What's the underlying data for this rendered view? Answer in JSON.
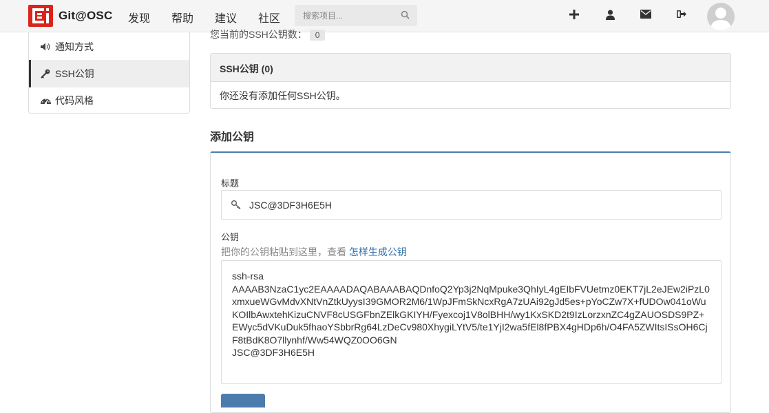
{
  "brand": {
    "name": "Git@OSC",
    "color": "#d9251c"
  },
  "nav": {
    "links": [
      "发现",
      "帮助",
      "建议",
      "社区"
    ],
    "search_placeholder": "搜索项目...",
    "icons": [
      "plus-icon",
      "user-icon",
      "envelope-icon",
      "sign-out-icon"
    ]
  },
  "sidebar": {
    "items": [
      {
        "label": "通知方式",
        "icon": "volume-icon",
        "active": false
      },
      {
        "label": "SSH公钥",
        "icon": "key-icon",
        "active": true
      },
      {
        "label": "代码风格",
        "icon": "dashboard-icon",
        "active": false
      }
    ]
  },
  "main": {
    "count_text": "您当前的SSH公钥数：",
    "count_value": "0",
    "panel_title": "SSH公钥 (0)",
    "panel_empty": "你还没有添加任何SSH公钥。",
    "section_title": "添加公钥",
    "form": {
      "title_label": "标题",
      "title_value": "JSC@3DF3H6E5H",
      "key_label": "公钥",
      "key_hint": "把你的公钥粘贴到这里，查看",
      "key_hint_link": "怎样生成公钥",
      "key_value": "ssh-rsa\nAAAAB3NzaC1yc2EAAAADAQABAAABAQDnfoQ2Yp3j2NqMpuke3QhIyL4gEIbFVUetmz0EKT7jL2eJEw2iPzL0xmxueWGvMdvXNtVnZtkUyysI39GMOR2M6/1WpJFmSkNcxRgA7zUAi92gJd5es+pYoCZw7X+fUDOw041oWuKOIlbAwxtehKizuCNVF8cUSGFbnZElkGKIYH/Fyexcoj1V8olBHH/wy1KxSKD2t9IzLorzxnZC4gZAUOSDS9PZ+EWyc5dVKuDuk5fhaoYSbbrRg64LzDeCv980XhygiLYtV5/te1YjI2wa5fEl8fPBX4gHDp6h/O4FA5ZWItsISsOH6CjF8tBdK8O7llynhf/Ww54WQZ0OO6GN\nJSC@3DF3H6E5H"
    }
  },
  "colors": {
    "accent": "#4b7cad",
    "link": "#2f6faa"
  }
}
